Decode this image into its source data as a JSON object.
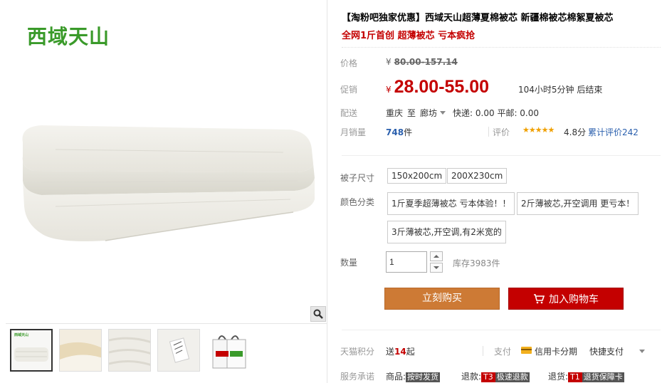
{
  "gallery": {
    "brand_logo": "西域天山",
    "thumb_logo": "西域天山"
  },
  "product": {
    "title": "【淘粉吧独家优惠】西域天山超薄夏棉被芯 新疆棉被芯棉絮夏被芯",
    "subtitle": "全网1斤首创 超薄被芯 亏本疯抢"
  },
  "price": {
    "label": "价格",
    "currency": "¥",
    "original": "80.00-157.14"
  },
  "promo": {
    "label": "促销",
    "currency": "¥",
    "price": "28.00-55.00",
    "countdown": "104小时5分钟 后结束"
  },
  "shipping": {
    "label": "配送",
    "from": "重庆",
    "to_word": "至",
    "destination": "廊坊",
    "express": "快递: 0.00 平邮: 0.00"
  },
  "sales": {
    "label": "月销量",
    "count": "748",
    "unit": "件",
    "rating_label": "评价",
    "stars": "★★★★★",
    "score": "4.8分",
    "reviews": "累计评价242"
  },
  "options": {
    "size_label": "被子尺寸",
    "sizes": [
      "150x200cm",
      "200X230cm"
    ],
    "color_label": "颜色分类",
    "colors": [
      "1斤夏季超薄被芯 亏本体验！！",
      "2斤薄被芯,开空调用 更亏本！",
      "3斤薄被芯,开空调,有2米宽的"
    ]
  },
  "quantity": {
    "label": "数量",
    "value": "1",
    "stock": "库存3983件"
  },
  "actions": {
    "buy": "立刻购买",
    "cart": "加入购物车"
  },
  "points": {
    "label": "天猫积分",
    "prefix": "送",
    "value": "14",
    "suffix": "起",
    "pay_label": "支付",
    "credit": "信用卡分期",
    "quick": "快捷支付"
  },
  "service": {
    "label": "服务承诺",
    "goods_label": "商品:",
    "goods_badge": "按时发货",
    "refund_label": "退款:",
    "refund_tag": "T3",
    "refund_badge": "极速退款",
    "return_label": "退货:",
    "return_tag": "T1",
    "return_badge": "退货保障卡"
  },
  "colors": {
    "accent_red": "#c40000",
    "buy_orange": "#cd7a35",
    "link_blue": "#2a5fad",
    "logo_green": "#3a9a2a"
  }
}
